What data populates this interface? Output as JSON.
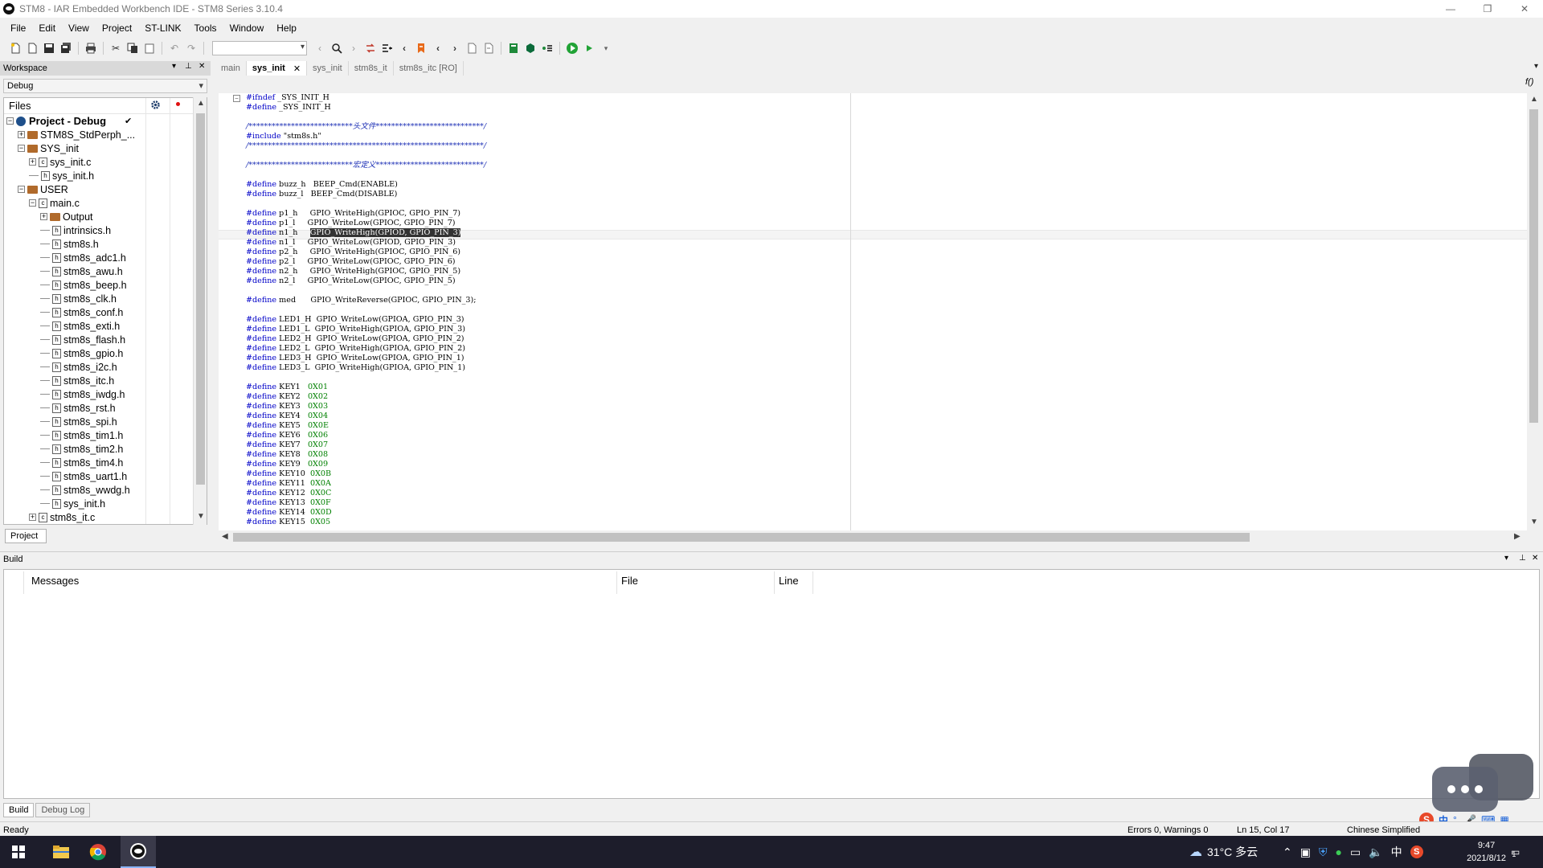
{
  "window": {
    "title": "STM8 - IAR Embedded Workbench IDE - STM8 Series 3.10.4",
    "controls": [
      "—",
      "❐",
      "✕"
    ]
  },
  "menu": [
    "File",
    "Edit",
    "View",
    "Project",
    "ST-LINK",
    "Tools",
    "Window",
    "Help"
  ],
  "workspace": {
    "title": "Workspace",
    "configuration": "Debug",
    "files_header": "Files",
    "bottom_tab": "Project",
    "tree": [
      {
        "label": "Project - Debug",
        "depth": 0,
        "type": "project",
        "expander": "−",
        "bold": true,
        "check": "✔"
      },
      {
        "label": "STM8S_StdPerph_...",
        "depth": 1,
        "type": "folder",
        "expander": "+"
      },
      {
        "label": "SYS_init",
        "depth": 1,
        "type": "folder",
        "expander": "−"
      },
      {
        "label": "sys_init.c",
        "depth": 2,
        "type": "cfile",
        "expander": "+"
      },
      {
        "label": "sys_init.h",
        "depth": 2,
        "type": "hfile",
        "expander": ""
      },
      {
        "label": "USER",
        "depth": 1,
        "type": "folder",
        "expander": "−"
      },
      {
        "label": "main.c",
        "depth": 2,
        "type": "cfile",
        "expander": "−"
      },
      {
        "label": "Output",
        "depth": 3,
        "type": "folder",
        "expander": "+"
      },
      {
        "label": "intrinsics.h",
        "depth": 3,
        "type": "hfile",
        "expander": ""
      },
      {
        "label": "stm8s.h",
        "depth": 3,
        "type": "hfile",
        "expander": ""
      },
      {
        "label": "stm8s_adc1.h",
        "depth": 3,
        "type": "hfile",
        "expander": ""
      },
      {
        "label": "stm8s_awu.h",
        "depth": 3,
        "type": "hfile",
        "expander": ""
      },
      {
        "label": "stm8s_beep.h",
        "depth": 3,
        "type": "hfile",
        "expander": ""
      },
      {
        "label": "stm8s_clk.h",
        "depth": 3,
        "type": "hfile",
        "expander": ""
      },
      {
        "label": "stm8s_conf.h",
        "depth": 3,
        "type": "hfile",
        "expander": ""
      },
      {
        "label": "stm8s_exti.h",
        "depth": 3,
        "type": "hfile",
        "expander": ""
      },
      {
        "label": "stm8s_flash.h",
        "depth": 3,
        "type": "hfile",
        "expander": ""
      },
      {
        "label": "stm8s_gpio.h",
        "depth": 3,
        "type": "hfile",
        "expander": ""
      },
      {
        "label": "stm8s_i2c.h",
        "depth": 3,
        "type": "hfile",
        "expander": ""
      },
      {
        "label": "stm8s_itc.h",
        "depth": 3,
        "type": "hfile",
        "expander": ""
      },
      {
        "label": "stm8s_iwdg.h",
        "depth": 3,
        "type": "hfile",
        "expander": ""
      },
      {
        "label": "stm8s_rst.h",
        "depth": 3,
        "type": "hfile",
        "expander": ""
      },
      {
        "label": "stm8s_spi.h",
        "depth": 3,
        "type": "hfile",
        "expander": ""
      },
      {
        "label": "stm8s_tim1.h",
        "depth": 3,
        "type": "hfile",
        "expander": ""
      },
      {
        "label": "stm8s_tim2.h",
        "depth": 3,
        "type": "hfile",
        "expander": ""
      },
      {
        "label": "stm8s_tim4.h",
        "depth": 3,
        "type": "hfile",
        "expander": ""
      },
      {
        "label": "stm8s_uart1.h",
        "depth": 3,
        "type": "hfile",
        "expander": ""
      },
      {
        "label": "stm8s_wwdg.h",
        "depth": 3,
        "type": "hfile",
        "expander": ""
      },
      {
        "label": "sys_init.h",
        "depth": 3,
        "type": "hfile",
        "expander": ""
      },
      {
        "label": "stm8s_it.c",
        "depth": 2,
        "type": "cfile",
        "expander": "+"
      }
    ]
  },
  "editor": {
    "tabs": [
      {
        "label": "main",
        "active": false
      },
      {
        "label": "sys_init",
        "active": true,
        "close": "✕"
      },
      {
        "label": "sys_init",
        "active": false
      },
      {
        "label": "stm8s_it",
        "active": false
      },
      {
        "label": "stm8s_itc [RO]",
        "active": false
      }
    ],
    "right_glyph": "f()",
    "code": [
      [
        [
          "kw",
          "#ifndef"
        ],
        [
          "t",
          " _SYS_INIT_H"
        ]
      ],
      [
        [
          "kw",
          "#define"
        ],
        [
          "t",
          " _SYS_INIT_H"
        ]
      ],
      [
        [
          "t",
          ""
        ]
      ],
      [
        [
          "cm",
          "/***************************头文件****************************/"
        ]
      ],
      [
        [
          "kw",
          "#include"
        ],
        [
          "t",
          " \"stm8s.h\""
        ]
      ],
      [
        [
          "cm",
          "/*************************************************************/"
        ]
      ],
      [
        [
          "t",
          ""
        ]
      ],
      [
        [
          "cm",
          "/***************************宏定义****************************/"
        ]
      ],
      [
        [
          "t",
          ""
        ]
      ],
      [
        [
          "kw",
          "#define"
        ],
        [
          "t",
          " buzz_h   BEEP_Cmd(ENABLE)"
        ]
      ],
      [
        [
          "kw",
          "#define"
        ],
        [
          "t",
          " buzz_l   BEEP_Cmd(DISABLE)"
        ]
      ],
      [
        [
          "t",
          ""
        ]
      ],
      [
        [
          "kw",
          "#define"
        ],
        [
          "t",
          " p1_h     GPIO_WriteHigh(GPIOC, GPIO_PIN_7)"
        ]
      ],
      [
        [
          "kw",
          "#define"
        ],
        [
          "t",
          " p1_l     GPIO_WriteLow(GPIOC, GPIO_PIN_7)"
        ]
      ],
      [
        [
          "kw",
          "#define"
        ],
        [
          "t",
          " n1_h     "
        ],
        [
          "sel",
          "GPIO_WriteHigh(GPIOD, GPIO_PIN_3)"
        ]
      ],
      [
        [
          "kw",
          "#define"
        ],
        [
          "t",
          " n1_l     GPIO_WriteLow(GPIOD, GPIO_PIN_3)"
        ]
      ],
      [
        [
          "kw",
          "#define"
        ],
        [
          "t",
          " p2_h     GPIO_WriteHigh(GPIOC, GPIO_PIN_6)"
        ]
      ],
      [
        [
          "kw",
          "#define"
        ],
        [
          "t",
          " p2_l     GPIO_WriteLow(GPIOC, GPIO_PIN_6)"
        ]
      ],
      [
        [
          "kw",
          "#define"
        ],
        [
          "t",
          " n2_h     GPIO_WriteHigh(GPIOC, GPIO_PIN_5)"
        ]
      ],
      [
        [
          "kw",
          "#define"
        ],
        [
          "t",
          " n2_l     GPIO_WriteLow(GPIOC, GPIO_PIN_5)"
        ]
      ],
      [
        [
          "t",
          ""
        ]
      ],
      [
        [
          "kw",
          "#define"
        ],
        [
          "t",
          " med      GPIO_WriteReverse(GPIOC, GPIO_PIN_3);"
        ]
      ],
      [
        [
          "t",
          ""
        ]
      ],
      [
        [
          "kw",
          "#define"
        ],
        [
          "t",
          " LED1_H  GPIO_WriteLow(GPIOA, GPIO_PIN_3)"
        ]
      ],
      [
        [
          "kw",
          "#define"
        ],
        [
          "t",
          " LED1_L  GPIO_WriteHigh(GPIOA, GPIO_PIN_3)"
        ]
      ],
      [
        [
          "kw",
          "#define"
        ],
        [
          "t",
          " LED2_H  GPIO_WriteLow(GPIOA, GPIO_PIN_2)"
        ]
      ],
      [
        [
          "kw",
          "#define"
        ],
        [
          "t",
          " LED2_L  GPIO_WriteHigh(GPIOA, GPIO_PIN_2)"
        ]
      ],
      [
        [
          "kw",
          "#define"
        ],
        [
          "t",
          " LED3_H  GPIO_WriteLow(GPIOA, GPIO_PIN_1)"
        ]
      ],
      [
        [
          "kw",
          "#define"
        ],
        [
          "t",
          " LED3_L  GPIO_WriteHigh(GPIOA, GPIO_PIN_1)"
        ]
      ],
      [
        [
          "t",
          ""
        ]
      ],
      [
        [
          "kw",
          "#define"
        ],
        [
          "t",
          " KEY1   "
        ],
        [
          "num",
          "0X01"
        ]
      ],
      [
        [
          "kw",
          "#define"
        ],
        [
          "t",
          " KEY2   "
        ],
        [
          "num",
          "0X02"
        ]
      ],
      [
        [
          "kw",
          "#define"
        ],
        [
          "t",
          " KEY3   "
        ],
        [
          "num",
          "0X03"
        ]
      ],
      [
        [
          "kw",
          "#define"
        ],
        [
          "t",
          " KEY4   "
        ],
        [
          "num",
          "0X04"
        ]
      ],
      [
        [
          "kw",
          "#define"
        ],
        [
          "t",
          " KEY5   "
        ],
        [
          "num",
          "0X0E"
        ]
      ],
      [
        [
          "kw",
          "#define"
        ],
        [
          "t",
          " KEY6   "
        ],
        [
          "num",
          "0X06"
        ]
      ],
      [
        [
          "kw",
          "#define"
        ],
        [
          "t",
          " KEY7   "
        ],
        [
          "num",
          "0X07"
        ]
      ],
      [
        [
          "kw",
          "#define"
        ],
        [
          "t",
          " KEY8   "
        ],
        [
          "num",
          "0X08"
        ]
      ],
      [
        [
          "kw",
          "#define"
        ],
        [
          "t",
          " KEY9   "
        ],
        [
          "num",
          "0X09"
        ]
      ],
      [
        [
          "kw",
          "#define"
        ],
        [
          "t",
          " KEY10  "
        ],
        [
          "num",
          "0X0B"
        ]
      ],
      [
        [
          "kw",
          "#define"
        ],
        [
          "t",
          " KEY11  "
        ],
        [
          "num",
          "0X0A"
        ]
      ],
      [
        [
          "kw",
          "#define"
        ],
        [
          "t",
          " KEY12  "
        ],
        [
          "num",
          "0X0C"
        ]
      ],
      [
        [
          "kw",
          "#define"
        ],
        [
          "t",
          " KEY13  "
        ],
        [
          "num",
          "0X0F"
        ]
      ],
      [
        [
          "kw",
          "#define"
        ],
        [
          "t",
          " KEY14  "
        ],
        [
          "num",
          "0X0D"
        ]
      ],
      [
        [
          "kw",
          "#define"
        ],
        [
          "t",
          " KEY15  "
        ],
        [
          "num",
          "0X05"
        ]
      ]
    ]
  },
  "build": {
    "title": "Build",
    "columns": [
      "Messages",
      "File",
      "Line"
    ],
    "tabs": [
      "Build",
      "Debug Log"
    ]
  },
  "status": {
    "ready": "Ready",
    "errors": "Errors 0, Warnings 0",
    "position": "Ln 15, Col 17",
    "language": "Chinese Simplified"
  },
  "taskbar": {
    "weather": "31°C  多云",
    "ime": "中",
    "time": "9:47",
    "date": "2021/8/12",
    "notif": "1"
  },
  "ime_toolbar": {
    "lang": "中",
    "punct": "°,"
  },
  "colors": {
    "keyword": "#0000c8",
    "comment": "#1c2fb5",
    "number": "#008000",
    "taskbar": "#1d1d2b"
  }
}
